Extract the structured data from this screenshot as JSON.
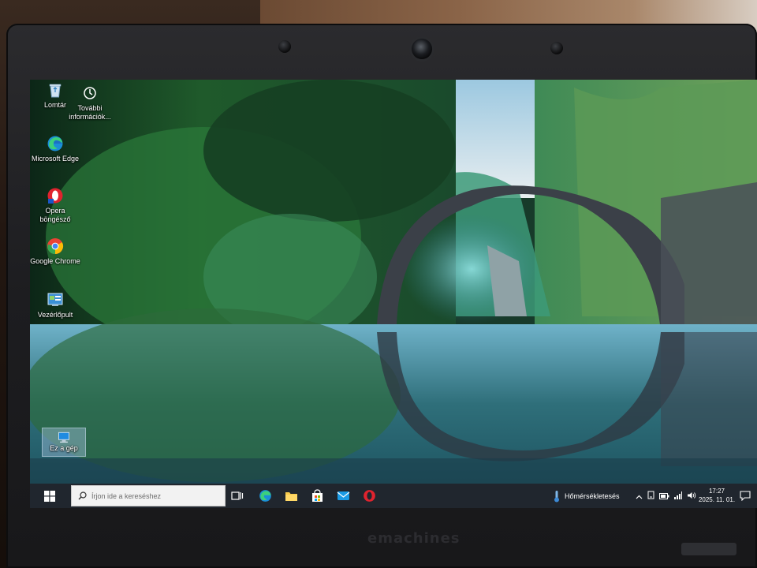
{
  "desktop": {
    "icons": [
      {
        "label": "Lomtár",
        "icon": "recycle-bin-icon"
      },
      {
        "label": "További információk...",
        "icon": "info-icon"
      },
      {
        "label": "Microsoft Edge",
        "icon": "edge-icon"
      },
      {
        "label": "Opera böngésző",
        "icon": "opera-icon"
      },
      {
        "label": "Google Chrome",
        "icon": "chrome-icon"
      },
      {
        "label": "Vezérlőpult",
        "icon": "control-panel-icon"
      },
      {
        "label": "Ez a gép",
        "icon": "this-pc-icon"
      }
    ]
  },
  "taskbar": {
    "search_placeholder": "Írjon ide a kereséshez",
    "pinned": [
      "task-view-icon",
      "edge-icon",
      "file-explorer-icon",
      "store-icon",
      "mail-icon",
      "opera-icon"
    ],
    "weather_label": "Hőmérsékletesés",
    "clock_time": "17:27",
    "clock_date": "2025. 11. 01.",
    "tray_icons": [
      "chevron-up-icon",
      "device-icon",
      "battery-icon",
      "network-icon",
      "volume-icon"
    ]
  },
  "device": {
    "brand": "emachines"
  },
  "colors": {
    "taskbar": "#20262e",
    "edge_blue": "#1a8ed8",
    "opera_red": "#e0232e",
    "chrome_green": "#34a853",
    "chrome_yellow": "#fbbc05",
    "chrome_red": "#ea4335"
  }
}
